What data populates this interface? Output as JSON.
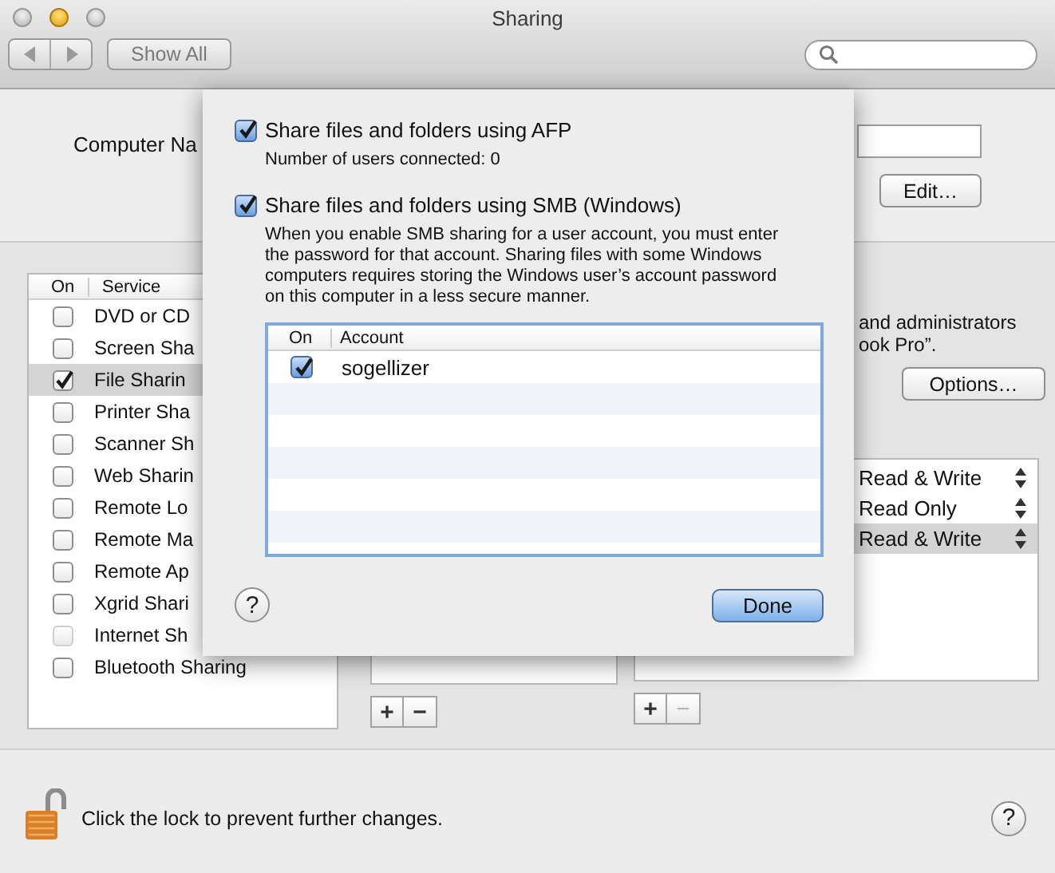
{
  "window": {
    "title": "Sharing",
    "traffic_lights": [
      {
        "kind": "close",
        "active": false
      },
      {
        "kind": "minimize",
        "active": true
      },
      {
        "kind": "zoom",
        "active": false
      }
    ]
  },
  "toolbar": {
    "show_all": "Show All"
  },
  "computer_name": {
    "label": "Computer Na",
    "edit_button": "Edit…"
  },
  "services": {
    "columns": [
      "On",
      "Service"
    ],
    "rows": [
      {
        "name": "DVD or CD",
        "checked": false,
        "selected": false,
        "disabled": false
      },
      {
        "name": "Screen Sha",
        "checked": false,
        "selected": false,
        "disabled": false
      },
      {
        "name": "File Sharin",
        "checked": true,
        "selected": true,
        "disabled": false
      },
      {
        "name": "Printer Sha",
        "checked": false,
        "selected": false,
        "disabled": false
      },
      {
        "name": "Scanner Sh",
        "checked": false,
        "selected": false,
        "disabled": false
      },
      {
        "name": "Web Sharin",
        "checked": false,
        "selected": false,
        "disabled": false
      },
      {
        "name": "Remote Lo",
        "checked": false,
        "selected": false,
        "disabled": false
      },
      {
        "name": "Remote Ma",
        "checked": false,
        "selected": false,
        "disabled": false
      },
      {
        "name": "Remote Ap",
        "checked": false,
        "selected": false,
        "disabled": false
      },
      {
        "name": "Xgrid Shari",
        "checked": false,
        "selected": false,
        "disabled": false
      },
      {
        "name": "Internet Sh",
        "checked": false,
        "selected": false,
        "disabled": true
      },
      {
        "name": "Bluetooth Sharing",
        "checked": false,
        "selected": false,
        "disabled": false
      }
    ]
  },
  "description": [
    "and administrators",
    "ook Pro”."
  ],
  "options_button": "Options…",
  "permissions": [
    {
      "value": "Read & Write",
      "selected": false
    },
    {
      "value": "Read Only",
      "selected": false
    },
    {
      "value": "Read & Write",
      "selected": true
    }
  ],
  "list_buttons": [
    {
      "add": "+",
      "remove": "−",
      "remove_disabled": false
    },
    {
      "add": "+",
      "remove": "−",
      "remove_disabled": true
    }
  ],
  "sheet": {
    "options": [
      {
        "label": "Share files and folders using AFP",
        "checked": true,
        "note": "Number of users connected: 0"
      },
      {
        "label": "Share files and folders using SMB (Windows)",
        "checked": true,
        "note": "When you enable SMB sharing for a user account, you must enter the password for that account. Sharing files with some Windows computers requires storing the Windows user’s account password on this computer in a less secure manner."
      }
    ],
    "accounts": {
      "columns": [
        "On",
        "Account"
      ],
      "rows": [
        {
          "name": "sogellizer",
          "checked": true
        }
      ]
    },
    "help": "?",
    "done_button": "Done"
  },
  "footer": {
    "lock_text": "Click the lock to prevent further changes.",
    "help": "?"
  }
}
